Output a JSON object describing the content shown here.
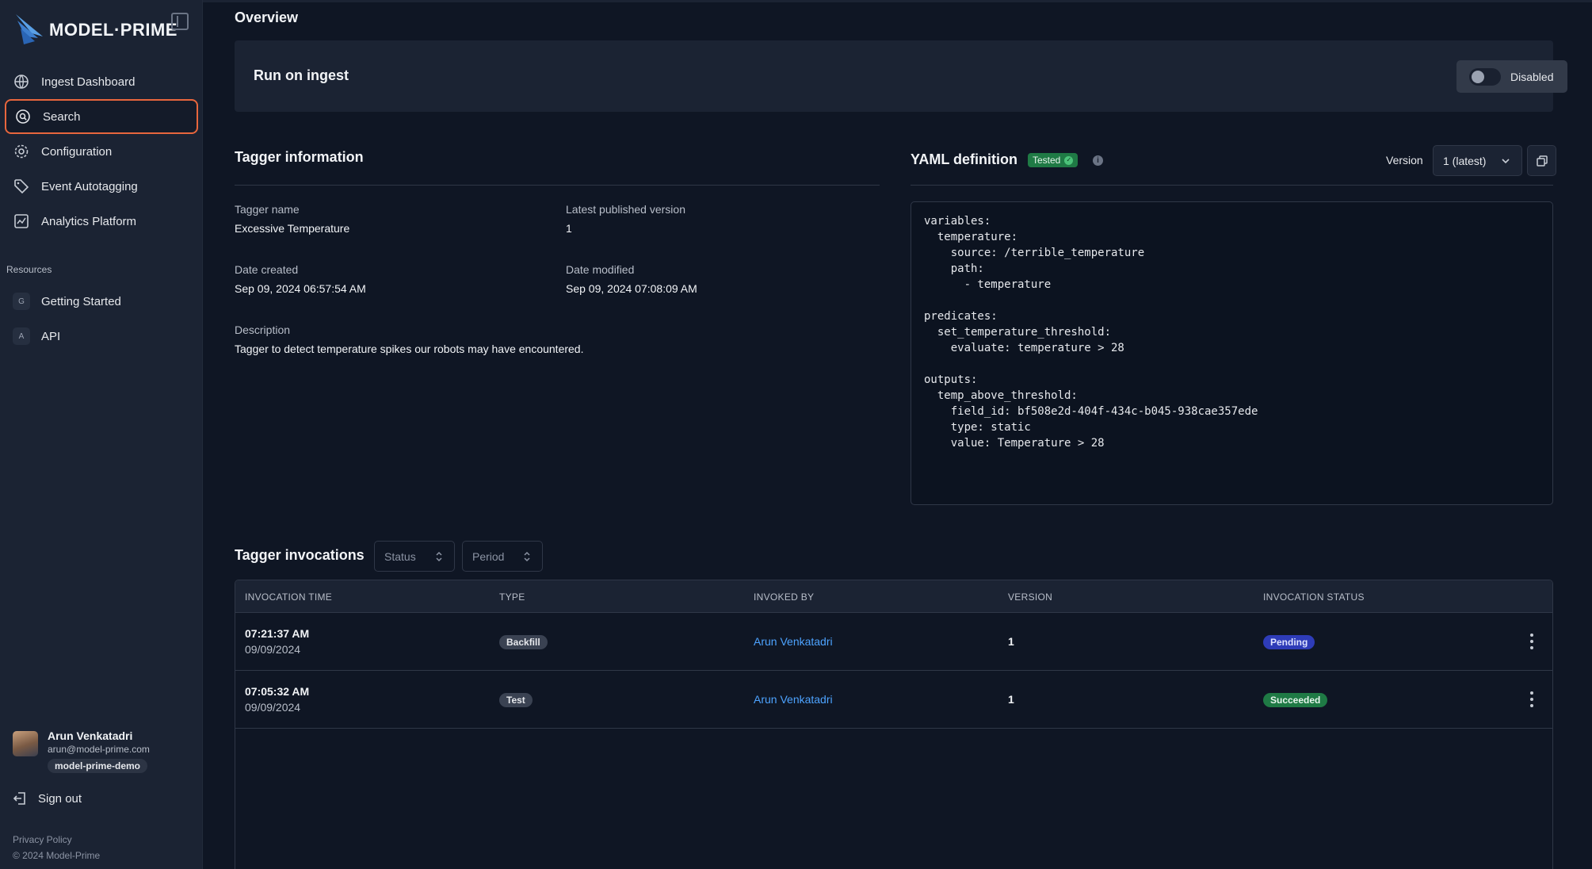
{
  "app": {
    "logo_text": "MODEL·PRIME"
  },
  "sidebar": {
    "nav": [
      {
        "label": "Ingest Dashboard",
        "icon": "globe-icon"
      },
      {
        "label": "Search",
        "icon": "search-icon",
        "active": true
      },
      {
        "label": "Configuration",
        "icon": "gear-icon"
      },
      {
        "label": "Event Autotagging",
        "icon": "tag-icon"
      },
      {
        "label": "Analytics Platform",
        "icon": "chart-icon"
      }
    ],
    "resources_label": "Resources",
    "resources": [
      {
        "badge": "G",
        "label": "Getting Started"
      },
      {
        "badge": "A",
        "label": "API"
      }
    ],
    "user": {
      "name": "Arun Venkatadri",
      "email": "arun@model-prime.com",
      "org": "model-prime-demo"
    },
    "signout_label": "Sign out",
    "privacy_label": "Privacy Policy",
    "copyright": "© 2024 Model-Prime"
  },
  "overview": {
    "title": "Overview",
    "run_on_ingest_label": "Run on ingest",
    "toggle_label": "Disabled"
  },
  "tagger_info": {
    "title": "Tagger information",
    "name_label": "Tagger name",
    "name_value": "Excessive Temperature",
    "published_label": "Latest published version",
    "published_value": "1",
    "created_label": "Date created",
    "created_value": "Sep 09, 2024 06:57:54 AM",
    "modified_label": "Date modified",
    "modified_value": "Sep 09, 2024 07:08:09 AM",
    "description_label": "Description",
    "description_value": "Tagger to detect temperature spikes our robots may have encountered."
  },
  "yaml": {
    "title": "YAML definition",
    "tested_label": "Tested",
    "version_label": "Version",
    "version_value": "1 (latest)",
    "code": "variables:\n  temperature:\n    source: /terrible_temperature\n    path:\n      - temperature\n\npredicates:\n  set_temperature_threshold:\n    evaluate: temperature > 28\n\noutputs:\n  temp_above_threshold:\n    field_id: bf508e2d-404f-434c-b045-938cae357ede\n    type: static\n    value: Temperature > 28"
  },
  "invocations": {
    "title": "Tagger invocations",
    "status_filter": "Status",
    "period_filter": "Period",
    "columns": [
      "INVOCATION TIME",
      "TYPE",
      "INVOKED BY",
      "VERSION",
      "INVOCATION STATUS"
    ],
    "rows": [
      {
        "time": "07:21:37 AM",
        "date": "09/09/2024",
        "type": "Backfill",
        "invoked_by": "Arun Venkatadri",
        "version": "1",
        "status": "Pending"
      },
      {
        "time": "07:05:32 AM",
        "date": "09/09/2024",
        "type": "Test",
        "invoked_by": "Arun Venkatadri",
        "version": "1",
        "status": "Succeeded"
      }
    ]
  },
  "colors": {
    "background": "#0f1624",
    "sidebar": "#1b2333",
    "active_outline": "#e8663d",
    "link": "#4da3ff",
    "pending": "#2e3cb8",
    "succeeded": "#1f7a45"
  }
}
